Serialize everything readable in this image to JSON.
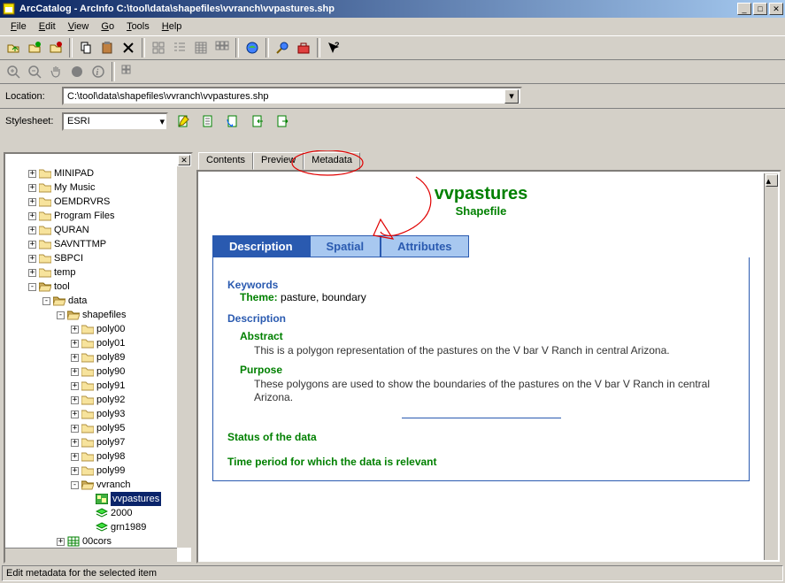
{
  "window": {
    "title": "ArcCatalog - ArcInfo   C:\\tool\\data\\shapefiles\\vvranch\\vvpastures.shp"
  },
  "menu": {
    "items": [
      "File",
      "Edit",
      "View",
      "Go",
      "Tools",
      "Help"
    ]
  },
  "location": {
    "label": "Location:",
    "value": "C:\\tool\\data\\shapefiles\\vvranch\\vvpastures.shp"
  },
  "stylesheet": {
    "label": "Stylesheet:",
    "value": "ESRI"
  },
  "tabs": {
    "items": [
      "Contents",
      "Preview",
      "Metadata"
    ],
    "active": 2
  },
  "tree": {
    "items": [
      {
        "indent": 1,
        "exp": "+",
        "icon": "folder",
        "label": "MINIPAD"
      },
      {
        "indent": 1,
        "exp": "+",
        "icon": "folder",
        "label": "My Music"
      },
      {
        "indent": 1,
        "exp": "+",
        "icon": "folder",
        "label": "OEMDRVRS"
      },
      {
        "indent": 1,
        "exp": "+",
        "icon": "folder",
        "label": "Program Files"
      },
      {
        "indent": 1,
        "exp": "+",
        "icon": "folder",
        "label": "QURAN"
      },
      {
        "indent": 1,
        "exp": "+",
        "icon": "folder",
        "label": "SAVNTTMP"
      },
      {
        "indent": 1,
        "exp": "+",
        "icon": "folder",
        "label": "SBPCI"
      },
      {
        "indent": 1,
        "exp": "+",
        "icon": "folder",
        "label": "temp"
      },
      {
        "indent": 1,
        "exp": "-",
        "icon": "folder-open",
        "label": "tool"
      },
      {
        "indent": 2,
        "exp": "-",
        "icon": "folder-open",
        "label": "data"
      },
      {
        "indent": 3,
        "exp": "-",
        "icon": "folder-open",
        "label": "shapefiles"
      },
      {
        "indent": 4,
        "exp": "+",
        "icon": "folder",
        "label": "poly00"
      },
      {
        "indent": 4,
        "exp": "+",
        "icon": "folder",
        "label": "poly01"
      },
      {
        "indent": 4,
        "exp": "+",
        "icon": "folder",
        "label": "poly89"
      },
      {
        "indent": 4,
        "exp": "+",
        "icon": "folder",
        "label": "poly90"
      },
      {
        "indent": 4,
        "exp": "+",
        "icon": "folder",
        "label": "poly91"
      },
      {
        "indent": 4,
        "exp": "+",
        "icon": "folder",
        "label": "poly92"
      },
      {
        "indent": 4,
        "exp": "+",
        "icon": "folder",
        "label": "poly93"
      },
      {
        "indent": 4,
        "exp": "+",
        "icon": "folder",
        "label": "poly95"
      },
      {
        "indent": 4,
        "exp": "+",
        "icon": "folder",
        "label": "poly97"
      },
      {
        "indent": 4,
        "exp": "+",
        "icon": "folder",
        "label": "poly98"
      },
      {
        "indent": 4,
        "exp": "+",
        "icon": "folder",
        "label": "poly99"
      },
      {
        "indent": 4,
        "exp": "-",
        "icon": "folder-open",
        "label": "vvranch"
      },
      {
        "indent": 5,
        "exp": " ",
        "icon": "shapefile",
        "label": "vvpastures",
        "selected": true
      },
      {
        "indent": 5,
        "exp": " ",
        "icon": "layer-green",
        "label": "2000"
      },
      {
        "indent": 5,
        "exp": " ",
        "icon": "layer-green",
        "label": "grn1989"
      },
      {
        "indent": 3,
        "exp": "+",
        "icon": "grid",
        "label": "00cors"
      }
    ]
  },
  "metadata": {
    "title": "vvpastures",
    "subtitle": "Shapefile",
    "meta_tabs": [
      "Description",
      "Spatial",
      "Attributes"
    ],
    "keywords_h": "Keywords",
    "theme_label": "Theme:",
    "theme_value": "pasture, boundary",
    "description_h": "Description",
    "abstract_h": "Abstract",
    "abstract_txt": "This is a polygon representation of the pastures on the V bar V Ranch in central Arizona.",
    "purpose_h": "Purpose",
    "purpose_txt": "These polygons are used to show the boundaries of the pastures on the V bar V Ranch in central Arizona.",
    "status_h": "Status of the data",
    "timeperiod_h": "Time period for which the data is relevant"
  },
  "statusbar": {
    "text": "Edit metadata for the selected item"
  }
}
